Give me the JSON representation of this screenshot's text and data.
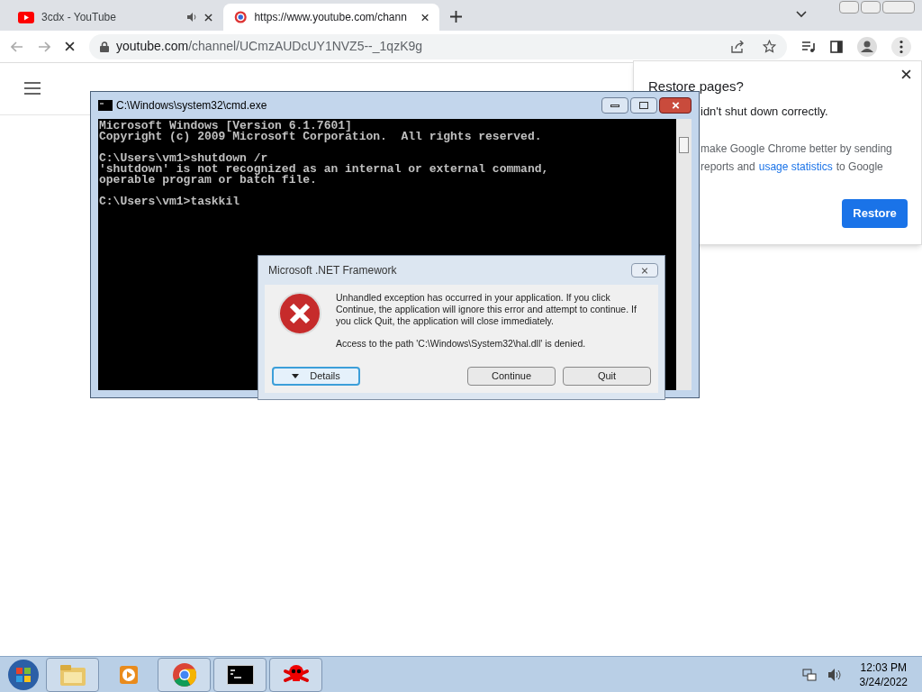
{
  "browser": {
    "tabs": [
      {
        "title": "3cdx - YouTube",
        "selected": false,
        "audio": true
      },
      {
        "title": "https://www.youtube.com/chann",
        "selected": true,
        "audio": false
      }
    ],
    "address": {
      "host": "youtube.com",
      "path": "/channel/UCmzAUDcUY1NVZ5--_1qzK9g"
    },
    "restore_popup": {
      "title": "Restore pages?",
      "message": "idn't shut down correctly.",
      "line_1": "make Google Chrome better by sending",
      "line_2_before": "reports and",
      "link": "usage statistics",
      "line_2_after": "to Google",
      "button": "Restore"
    }
  },
  "console": {
    "title": "C:\\Windows\\system32\\cmd.exe",
    "blocks": [
      [
        "Microsoft Windows [Version 6.1.7601]",
        "Copyright (c) 2009 Microsoft Corporation.  All rights reserved."
      ],
      [
        "C:\\Users\\vm1>shutdown /r",
        "'shutdown' is not recognized as an internal or external command,",
        "operable program or batch file."
      ],
      [
        "C:\\Users\\vm1>taskkil"
      ]
    ]
  },
  "dialog": {
    "title": "Microsoft .NET Framework",
    "message": "Unhandled exception has occurred in your application. If you click Continue, the application will ignore this error and attempt to continue. If you click Quit, the application will close immediately.",
    "detail": "Access to the path 'C:\\Windows\\System32\\hal.dll' is denied.",
    "buttons": [
      {
        "label": "Details",
        "focused": true
      },
      {
        "label": "Continue",
        "focused": false
      },
      {
        "label": "Quit",
        "focused": false
      }
    ]
  },
  "taskbar": {
    "apps": [
      {
        "kind": "folder",
        "running": true
      },
      {
        "kind": "media",
        "running": false
      },
      {
        "kind": "chrome",
        "running": true
      },
      {
        "kind": "console",
        "running": true
      },
      {
        "kind": "skull",
        "running": true
      }
    ],
    "time": "12:03 PM",
    "date": "3/24/2022"
  }
}
